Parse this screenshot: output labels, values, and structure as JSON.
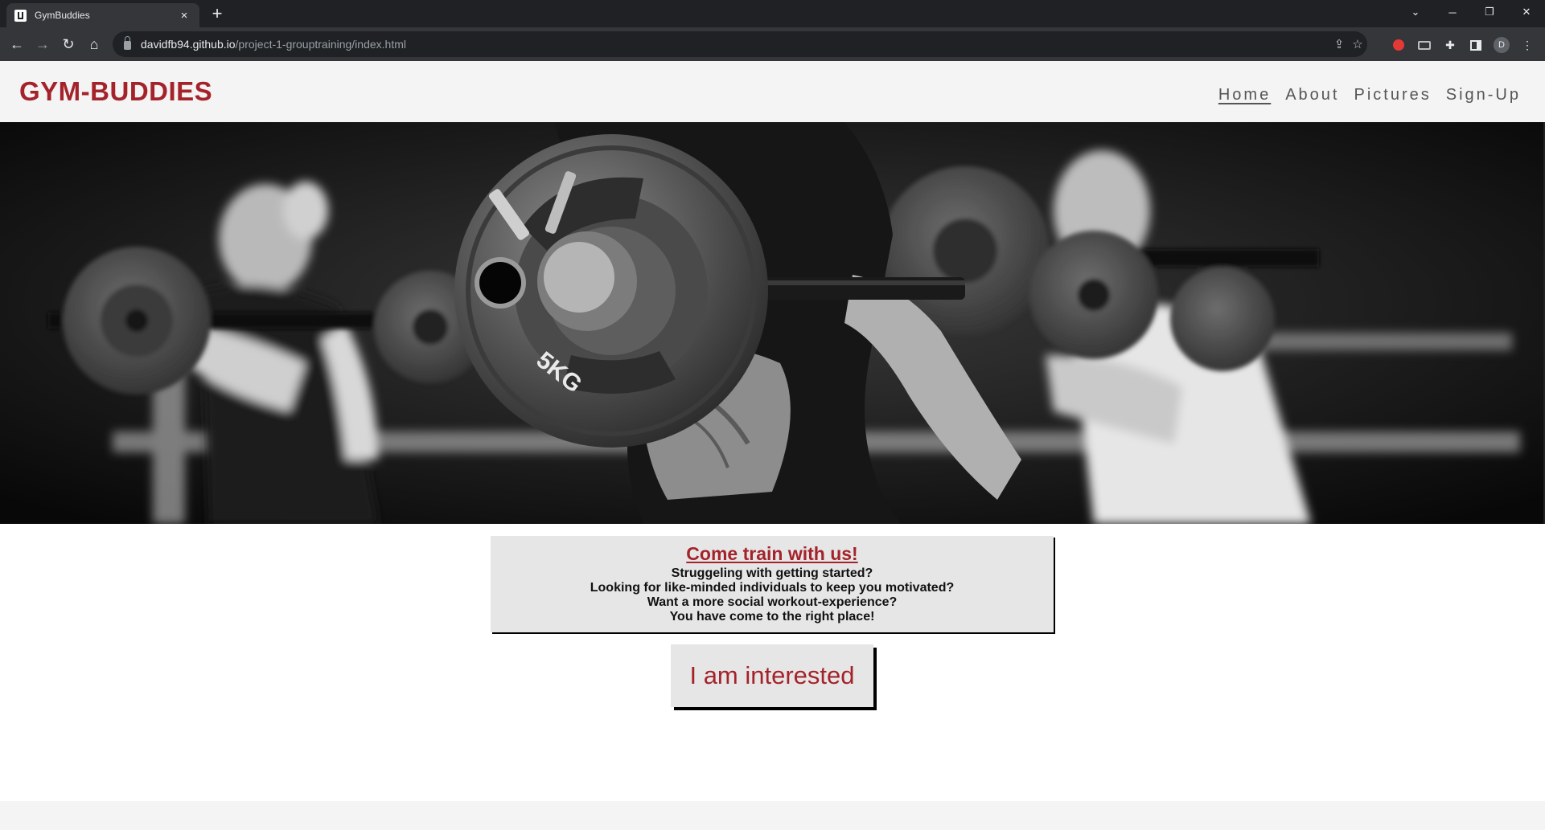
{
  "browser": {
    "tab_title": "GymBuddies",
    "tab_close": "×",
    "new_tab": "+",
    "url_host": "davidfb94.github.io",
    "url_path": "/project-1-grouptraining/index.html",
    "avatar_letter": "D"
  },
  "site": {
    "logo": "GYM-BUDDIES",
    "nav": [
      "Home",
      "About",
      "Pictures",
      "Sign-Up"
    ],
    "active_nav": "Home"
  },
  "hero": {
    "plate_label": "5KG"
  },
  "card": {
    "heading": "Come train with us!",
    "lines": [
      "Struggeling with getting started?",
      "Looking for like-minded individuals to keep you motivated?",
      "Want a more social workout-experience?",
      "You have come to the right place!"
    ]
  },
  "cta": {
    "label": "I am interested"
  },
  "colors": {
    "brand_red": "#a4232b",
    "card_bg": "#e6e6e6",
    "header_bg": "#f4f4f4"
  }
}
